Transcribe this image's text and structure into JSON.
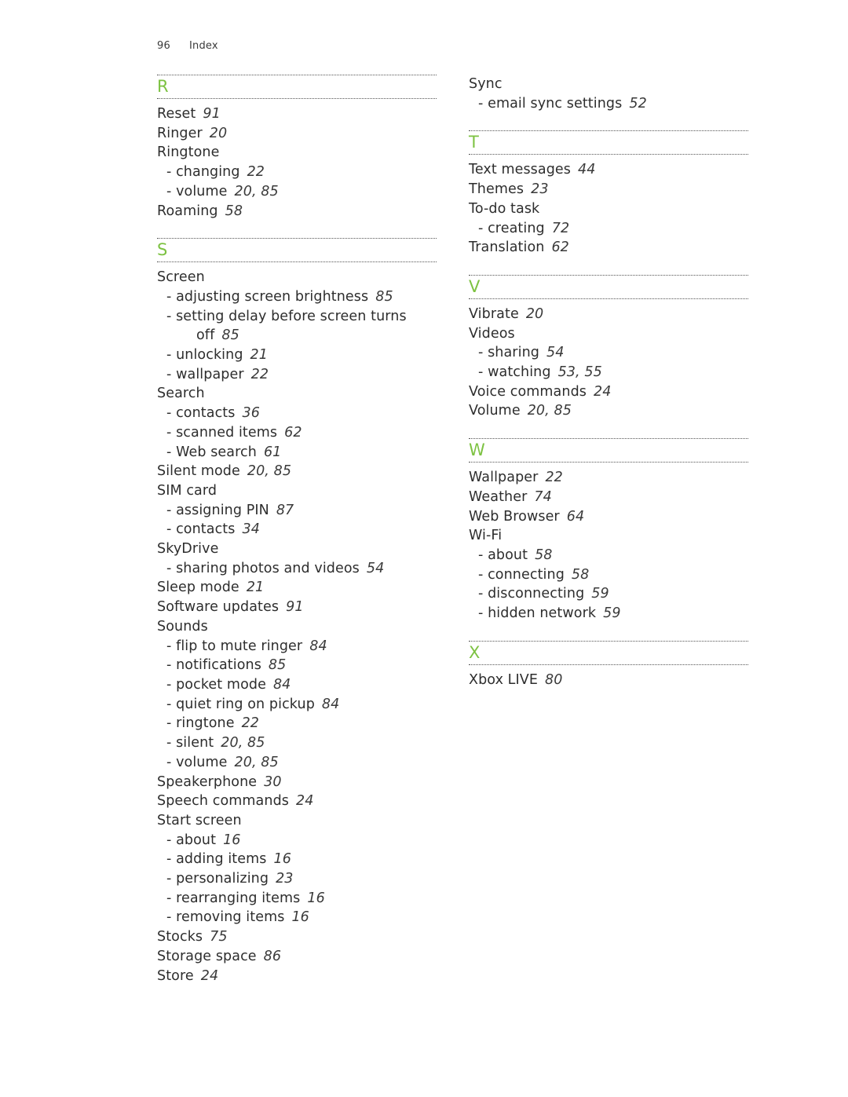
{
  "header": {
    "page_number": "96",
    "section_title": "Index"
  },
  "accent_color": "#7dc242",
  "columns": [
    {
      "lead_entries": [],
      "sections": [
        {
          "letter": "R",
          "entries": [
            {
              "term": "Reset",
              "pages": "91",
              "level": 0
            },
            {
              "term": "Ringer",
              "pages": "20",
              "level": 0
            },
            {
              "term": "Ringtone",
              "pages": "",
              "level": 0
            },
            {
              "term": "- changing",
              "pages": "22",
              "level": 1
            },
            {
              "term": "- volume",
              "pages": "20, 85",
              "level": 1
            },
            {
              "term": "Roaming",
              "pages": "58",
              "level": 0
            }
          ]
        },
        {
          "letter": "S",
          "entries": [
            {
              "term": "Screen",
              "pages": "",
              "level": 0
            },
            {
              "term": "- adjusting screen brightness",
              "pages": "85",
              "level": 1
            },
            {
              "term": "- setting delay before screen turns",
              "continuation": "off",
              "pages": "85",
              "level": 1
            },
            {
              "term": "- unlocking",
              "pages": "21",
              "level": 1
            },
            {
              "term": "- wallpaper",
              "pages": "22",
              "level": 1
            },
            {
              "term": "Search",
              "pages": "",
              "level": 0
            },
            {
              "term": "- contacts",
              "pages": "36",
              "level": 1
            },
            {
              "term": "- scanned items",
              "pages": "62",
              "level": 1
            },
            {
              "term": "- Web search",
              "pages": "61",
              "level": 1
            },
            {
              "term": "Silent mode",
              "pages": "20, 85",
              "level": 0
            },
            {
              "term": "SIM card",
              "pages": "",
              "level": 0
            },
            {
              "term": "- assigning PIN",
              "pages": "87",
              "level": 1
            },
            {
              "term": "- contacts",
              "pages": "34",
              "level": 1
            },
            {
              "term": "SkyDrive",
              "pages": "",
              "level": 0
            },
            {
              "term": "- sharing photos and videos",
              "pages": "54",
              "level": 1
            },
            {
              "term": "Sleep mode",
              "pages": "21",
              "level": 0
            },
            {
              "term": "Software updates",
              "pages": "91",
              "level": 0
            },
            {
              "term": "Sounds",
              "pages": "",
              "level": 0
            },
            {
              "term": "- flip to mute ringer",
              "pages": "84",
              "level": 1
            },
            {
              "term": "- notifications",
              "pages": "85",
              "level": 1
            },
            {
              "term": "- pocket mode",
              "pages": "84",
              "level": 1
            },
            {
              "term": "- quiet ring on pickup",
              "pages": "84",
              "level": 1
            },
            {
              "term": "- ringtone",
              "pages": "22",
              "level": 1
            },
            {
              "term": "- silent",
              "pages": "20, 85",
              "level": 1
            },
            {
              "term": "- volume",
              "pages": "20, 85",
              "level": 1
            },
            {
              "term": "Speakerphone",
              "pages": "30",
              "level": 0
            },
            {
              "term": "Speech commands",
              "pages": "24",
              "level": 0
            },
            {
              "term": "Start screen",
              "pages": "",
              "level": 0
            },
            {
              "term": "- about",
              "pages": "16",
              "level": 1
            },
            {
              "term": "- adding items",
              "pages": "16",
              "level": 1
            },
            {
              "term": "- personalizing",
              "pages": "23",
              "level": 1
            },
            {
              "term": "- rearranging items",
              "pages": "16",
              "level": 1
            },
            {
              "term": "- removing items",
              "pages": "16",
              "level": 1
            },
            {
              "term": "Stocks",
              "pages": "75",
              "level": 0
            },
            {
              "term": "Storage space",
              "pages": "86",
              "level": 0
            },
            {
              "term": "Store",
              "pages": "24",
              "level": 0
            }
          ]
        }
      ]
    },
    {
      "lead_entries": [
        {
          "term": "Sync",
          "pages": "",
          "level": 0
        },
        {
          "term": "- email sync settings",
          "pages": "52",
          "level": 1
        }
      ],
      "sections": [
        {
          "letter": "T",
          "entries": [
            {
              "term": "Text messages",
              "pages": "44",
              "level": 0
            },
            {
              "term": "Themes",
              "pages": "23",
              "level": 0
            },
            {
              "term": "To-do task",
              "pages": "",
              "level": 0
            },
            {
              "term": "- creating",
              "pages": "72",
              "level": 1
            },
            {
              "term": "Translation",
              "pages": "62",
              "level": 0
            }
          ]
        },
        {
          "letter": "V",
          "entries": [
            {
              "term": "Vibrate",
              "pages": "20",
              "level": 0
            },
            {
              "term": "Videos",
              "pages": "",
              "level": 0
            },
            {
              "term": "- sharing",
              "pages": "54",
              "level": 1
            },
            {
              "term": "- watching",
              "pages": "53, 55",
              "level": 1
            },
            {
              "term": "Voice commands",
              "pages": "24",
              "level": 0
            },
            {
              "term": "Volume",
              "pages": "20, 85",
              "level": 0
            }
          ]
        },
        {
          "letter": "W",
          "entries": [
            {
              "term": "Wallpaper",
              "pages": "22",
              "level": 0
            },
            {
              "term": "Weather",
              "pages": "74",
              "level": 0
            },
            {
              "term": "Web Browser",
              "pages": "64",
              "level": 0
            },
            {
              "term": "Wi-Fi",
              "pages": "",
              "level": 0
            },
            {
              "term": "- about",
              "pages": "58",
              "level": 1
            },
            {
              "term": "- connecting",
              "pages": "58",
              "level": 1
            },
            {
              "term": "- disconnecting",
              "pages": "59",
              "level": 1
            },
            {
              "term": "- hidden network",
              "pages": "59",
              "level": 1
            }
          ]
        },
        {
          "letter": "X",
          "entries": [
            {
              "term": "Xbox LIVE",
              "pages": "80",
              "level": 0
            }
          ]
        }
      ]
    }
  ]
}
